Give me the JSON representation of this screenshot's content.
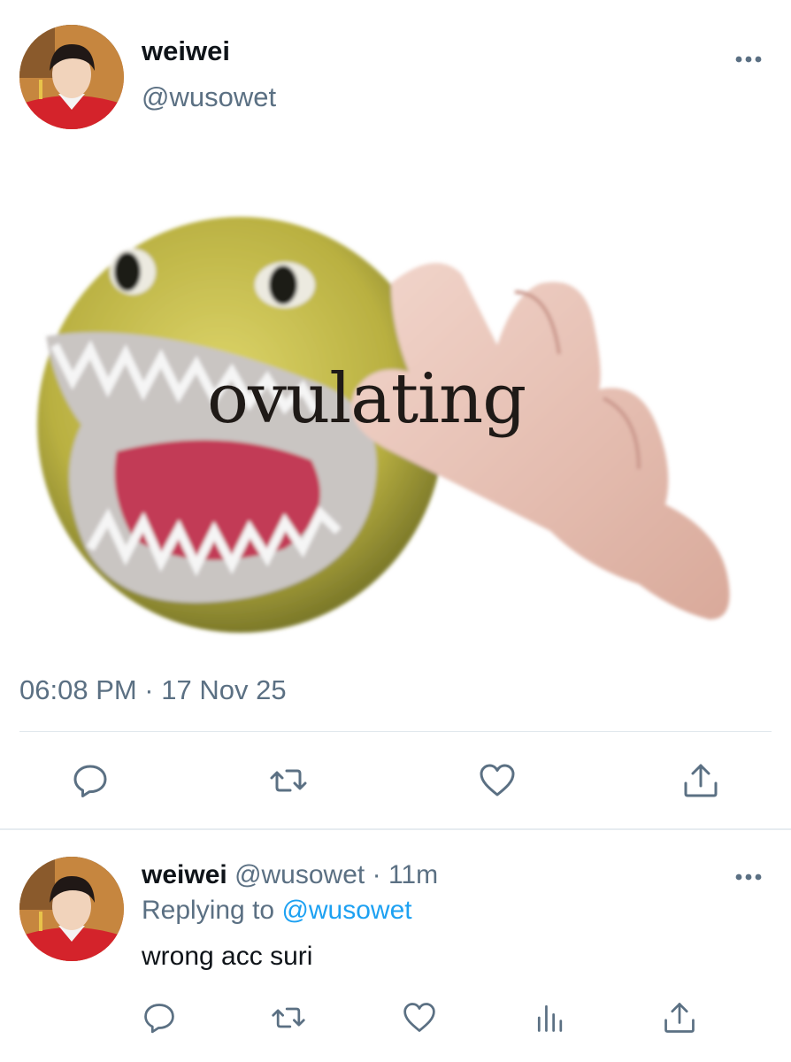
{
  "tweet": {
    "author_name": "weiwei",
    "author_handle": "@wusowet",
    "more_icon": "more-horizontal-icon",
    "image_caption": "ovulating",
    "timestamp": "06:08 PM · 17 Nov 25",
    "actions": [
      "reply-icon",
      "retweet-icon",
      "like-icon",
      "share-icon"
    ]
  },
  "reply": {
    "author_name": "weiwei",
    "author_handle": "@wusowet",
    "separator": "·",
    "age": "11m",
    "replying_to_prefix": "Replying to",
    "replying_to_handle": "@wusowet",
    "text": "wrong acc suri",
    "actions": [
      "reply-icon",
      "retweet-icon",
      "like-icon",
      "analytics-icon",
      "share-icon"
    ]
  },
  "colors": {
    "primary_text": "#0f1419",
    "secondary_text": "#5b7083",
    "link": "#1da1f2",
    "divider": "#e1e8ed"
  }
}
